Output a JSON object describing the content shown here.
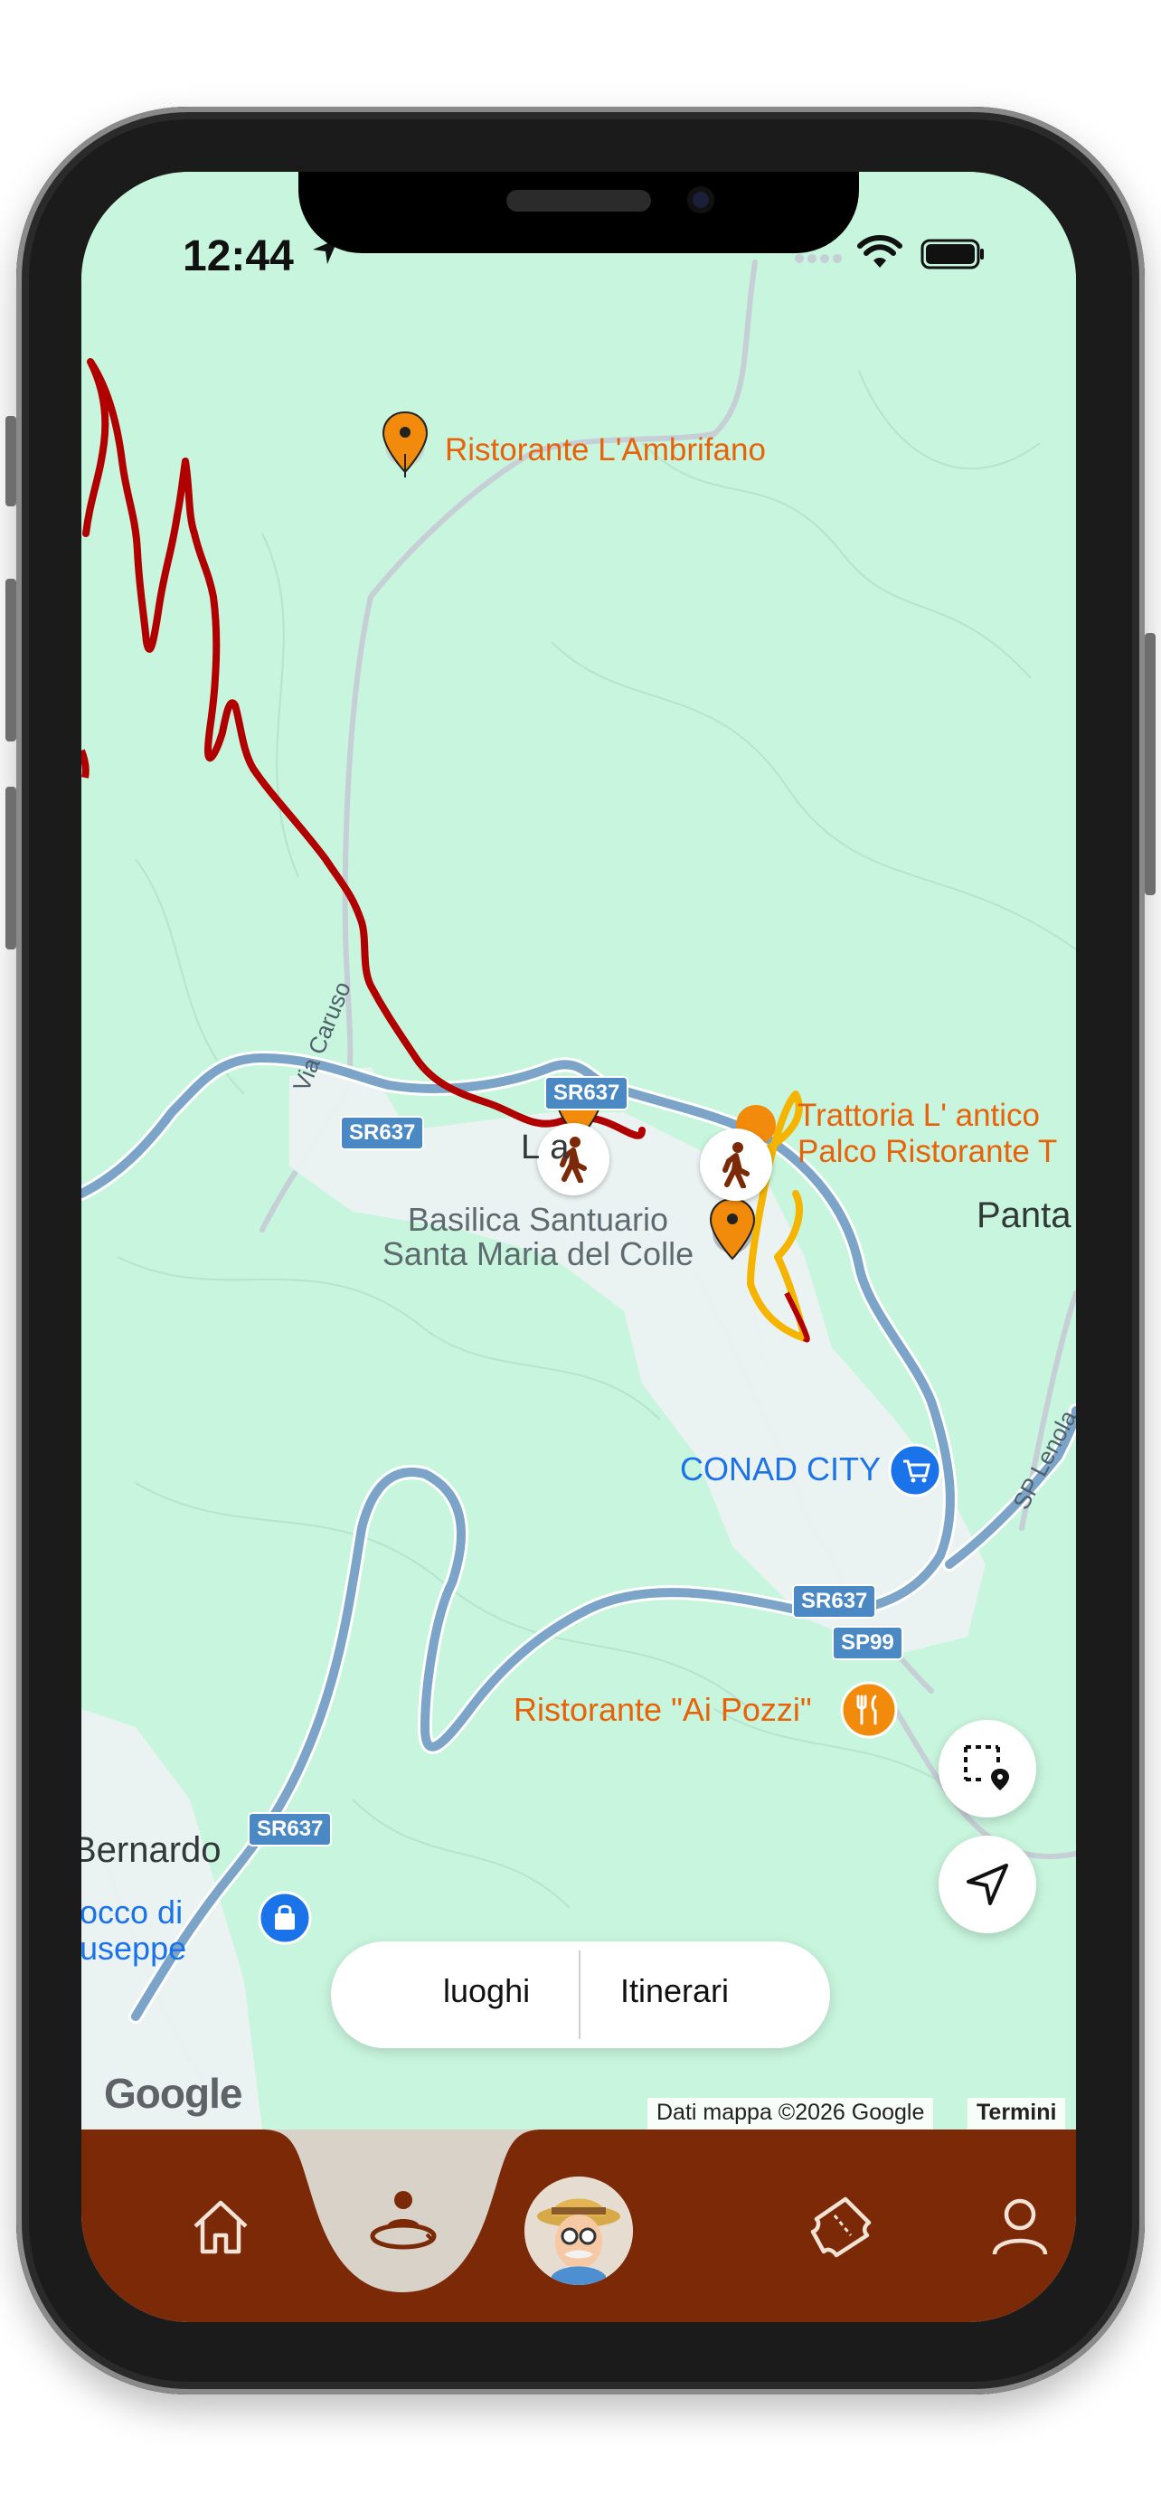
{
  "status_bar": {
    "time": "12:44"
  },
  "map": {
    "pois": {
      "ambrifano": "Ristorante L'Ambrifano",
      "trattoria_line1": "Trattoria L' antico",
      "trattoria_line2": "Palco Ristorante T",
      "basilica_line1": "Basilica Santuario",
      "basilica_line2": "Santa Maria del Colle",
      "conad": "CONAD CITY",
      "ai_pozzi": "Ristorante \"Ai Pozzi\"",
      "rocco_line1": "occo di",
      "rocco_line2": "useppe"
    },
    "places": {
      "town_partial": "L     a",
      "panta": "Panta",
      "bernardo": "Bernardo"
    },
    "roads": {
      "via_caruso": "Via Caruso",
      "sp_lenola": "SP Lenola",
      "sr637": "SR637",
      "sp99": "SP99"
    },
    "colors": {
      "land": "#c8f5dd",
      "road_major": "#7ba4c8",
      "road_minor": "#c6ced6",
      "route_red": "#b00000",
      "route_yellow": "#f4b400",
      "pin_orange": "#f28b0c"
    }
  },
  "attribution": {
    "logo": "Google",
    "data": "Dati mappa ©2026 Google",
    "terms": "Termini"
  },
  "segment_toggle": {
    "left_label": "luoghi",
    "right_label": "Itinerari"
  },
  "tabbar": {
    "items": [
      "home-icon",
      "explore-person-icon",
      "guide-avatar",
      "ticket-icon",
      "profile-icon"
    ],
    "active_index": 1,
    "background": "#7b2906"
  }
}
